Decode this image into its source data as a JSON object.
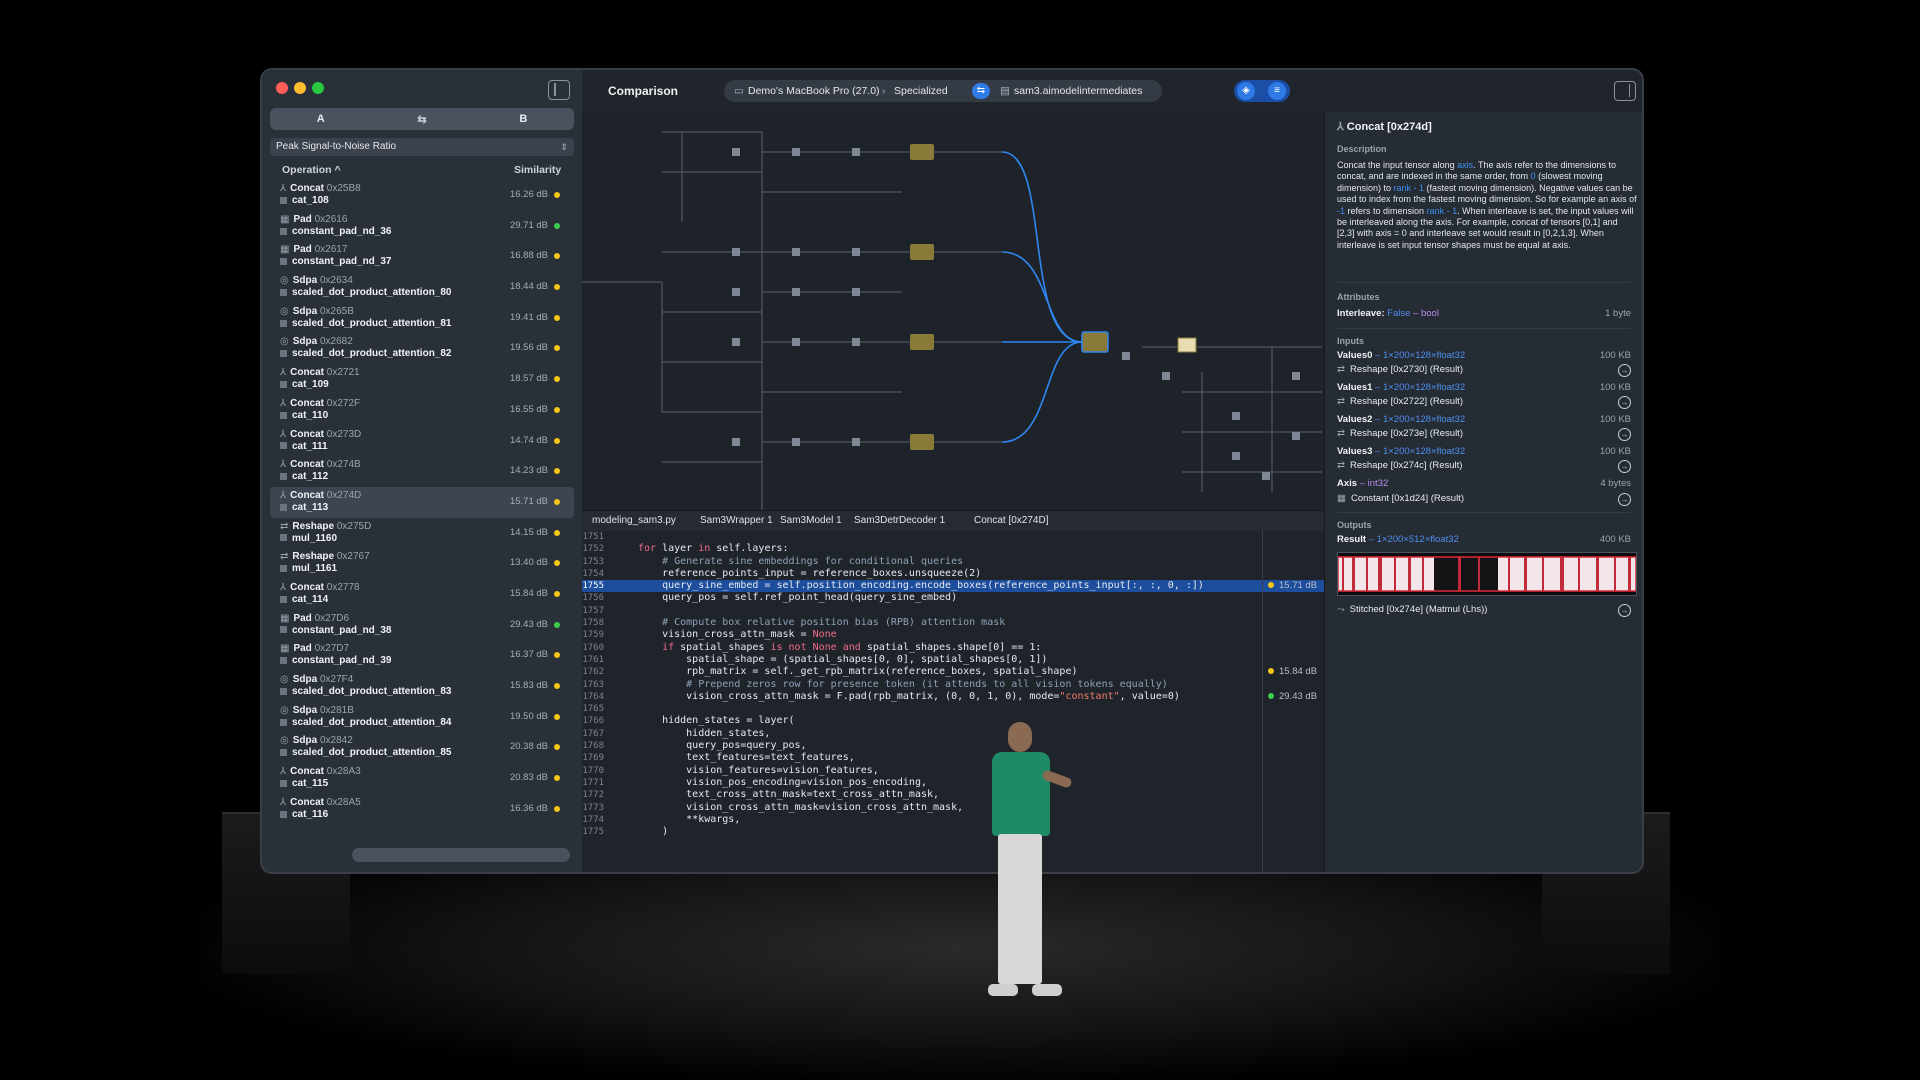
{
  "window": {
    "title": "Comparison",
    "breadcrumb": {
      "device": "Demo's MacBook Pro (27.0)",
      "mode": "Specialized",
      "file": "sam3.aimodelintermediates"
    }
  },
  "sidebar": {
    "segments": [
      "A",
      "⇆",
      "B"
    ],
    "metric": "Peak Signal-to-Noise Ratio",
    "col_operation": "Operation ^",
    "col_similarity": "Similarity",
    "colors": {
      "yellow": "#f5c518",
      "green": "#3ccf4e"
    },
    "ops": [
      {
        "type": "Concat",
        "addr": "0x25B8",
        "name": "cat_108",
        "sim": "16.26 dB",
        "dot": "yellow"
      },
      {
        "type": "Pad",
        "addr": "0x2616",
        "name": "constant_pad_nd_36",
        "sim": "29.71 dB",
        "dot": "green"
      },
      {
        "type": "Pad",
        "addr": "0x2617",
        "name": "constant_pad_nd_37",
        "sim": "16.88 dB",
        "dot": "yellow"
      },
      {
        "type": "Sdpa",
        "addr": "0x2634",
        "name": "scaled_dot_product_attention_80",
        "sim": "18.44 dB",
        "dot": "yellow"
      },
      {
        "type": "Sdpa",
        "addr": "0x265B",
        "name": "scaled_dot_product_attention_81",
        "sim": "19.41 dB",
        "dot": "yellow"
      },
      {
        "type": "Sdpa",
        "addr": "0x2682",
        "name": "scaled_dot_product_attention_82",
        "sim": "19.56 dB",
        "dot": "yellow"
      },
      {
        "type": "Concat",
        "addr": "0x2721",
        "name": "cat_109",
        "sim": "18.57 dB",
        "dot": "yellow"
      },
      {
        "type": "Concat",
        "addr": "0x272F",
        "name": "cat_110",
        "sim": "16.55 dB",
        "dot": "yellow"
      },
      {
        "type": "Concat",
        "addr": "0x273D",
        "name": "cat_111",
        "sim": "14.74 dB",
        "dot": "yellow"
      },
      {
        "type": "Concat",
        "addr": "0x274B",
        "name": "cat_112",
        "sim": "14.23 dB",
        "dot": "yellow"
      },
      {
        "type": "Concat",
        "addr": "0x274D",
        "name": "cat_113",
        "sim": "15.71 dB",
        "dot": "yellow",
        "selected": true
      },
      {
        "type": "Reshape",
        "addr": "0x275D",
        "name": "mul_1160",
        "sim": "14.15 dB",
        "dot": "yellow"
      },
      {
        "type": "Reshape",
        "addr": "0x2767",
        "name": "mul_1161",
        "sim": "13.40 dB",
        "dot": "yellow"
      },
      {
        "type": "Concat",
        "addr": "0x2778",
        "name": "cat_114",
        "sim": "15.84 dB",
        "dot": "yellow"
      },
      {
        "type": "Pad",
        "addr": "0x27D6",
        "name": "constant_pad_nd_38",
        "sim": "29.43 dB",
        "dot": "green"
      },
      {
        "type": "Pad",
        "addr": "0x27D7",
        "name": "constant_pad_nd_39",
        "sim": "16.37 dB",
        "dot": "yellow"
      },
      {
        "type": "Sdpa",
        "addr": "0x27F4",
        "name": "scaled_dot_product_attention_83",
        "sim": "15.83 dB",
        "dot": "yellow"
      },
      {
        "type": "Sdpa",
        "addr": "0x281B",
        "name": "scaled_dot_product_attention_84",
        "sim": "19.50 dB",
        "dot": "yellow"
      },
      {
        "type": "Sdpa",
        "addr": "0x2842",
        "name": "scaled_dot_product_attention_85",
        "sim": "20.38 dB",
        "dot": "yellow"
      },
      {
        "type": "Concat",
        "addr": "0x28A3",
        "name": "cat_115",
        "sim": "20.83 dB",
        "dot": "yellow"
      },
      {
        "type": "Concat",
        "addr": "0x28A5",
        "name": "cat_116",
        "sim": "16.36 dB",
        "dot": "yellow"
      }
    ]
  },
  "code": {
    "breadcrumb": [
      "modeling_sam3.py",
      "Sam3Wrapper 1",
      "Sam3Model 1",
      "Sam3DetrDecoder 1",
      "Concat [0x274D]"
    ],
    "highlight_line": "1755",
    "lines": [
      {
        "n": "1751",
        "t": ""
      },
      {
        "n": "1752",
        "t": "for layer in self.layers:",
        "cls": "k1"
      },
      {
        "n": "1753",
        "t": "    # Generate sine embeddings for conditional queries",
        "cls": "cm"
      },
      {
        "n": "1754",
        "t": "    reference_points_input = reference_boxes.unsqueeze(2)"
      },
      {
        "n": "1755",
        "t": "    query_sine_embed = self.position_encoding.encode_boxes(reference_points_input[:, :, 0, :])",
        "hl": true,
        "mark": "15.71 dB",
        "dot": "yellow"
      },
      {
        "n": "1756",
        "t": "    query_pos = self.ref_point_head(query_sine_embed)"
      },
      {
        "n": "1757",
        "t": ""
      },
      {
        "n": "1758",
        "t": "    # Compute box relative position bias (RPB) attention mask",
        "cls": "cm"
      },
      {
        "n": "1759",
        "t": "    vision_cross_attn_mask = None"
      },
      {
        "n": "1760",
        "t": "    if spatial_shapes is not None and spatial_shapes.shape[0] == 1:",
        "cls": "k2"
      },
      {
        "n": "1761",
        "t": "        spatial_shape = (spatial_shapes[0, 0], spatial_shapes[0, 1])"
      },
      {
        "n": "1762",
        "t": "        rpb_matrix = self._get_rpb_matrix(reference_boxes, spatial_shape)",
        "mark": "15.84 dB",
        "dot": "yellow"
      },
      {
        "n": "1763",
        "t": "        # Prepend zeros row for presence token (it attends to all vision tokens equally)",
        "cls": "cm"
      },
      {
        "n": "1764",
        "t": "        vision_cross_attn_mask = F.pad(rpb_matrix, (0, 0, 1, 0), mode=\"constant\", value=0)",
        "mark": "29.43 dB",
        "dot": "green"
      },
      {
        "n": "1765",
        "t": ""
      },
      {
        "n": "1766",
        "t": "    hidden_states = layer("
      },
      {
        "n": "1767",
        "t": "        hidden_states,"
      },
      {
        "n": "1768",
        "t": "        query_pos=query_pos,"
      },
      {
        "n": "1769",
        "t": "        text_features=text_features,"
      },
      {
        "n": "1770",
        "t": "        vision_features=vision_features,"
      },
      {
        "n": "1771",
        "t": "        vision_pos_encoding=vision_pos_encoding,"
      },
      {
        "n": "1772",
        "t": "        text_cross_attn_mask=text_cross_attn_mask,"
      },
      {
        "n": "1773",
        "t": "        vision_cross_attn_mask=vision_cross_attn_mask,"
      },
      {
        "n": "1774",
        "t": "        **kwargs,"
      },
      {
        "n": "1775",
        "t": "    )"
      }
    ]
  },
  "inspector": {
    "title": "Concat [0x274d]",
    "description_label": "Description",
    "description_parts": [
      {
        "t": "Concat the input tensor along "
      },
      {
        "t": "axis",
        "h": true
      },
      {
        "t": ". The axis refer to the dimensions to concat, and are indexed in the same order, from "
      },
      {
        "t": "0",
        "h": true
      },
      {
        "t": " (slowest moving dimension) to "
      },
      {
        "t": "rank - 1",
        "h": true
      },
      {
        "t": " (fastest moving dimension). Negative values can be used to index from the fastest moving dimension. So for example an axis of "
      },
      {
        "t": "-1",
        "h": true
      },
      {
        "t": " refers to dimension "
      },
      {
        "t": "rank - 1",
        "h": true
      },
      {
        "t": ". When interleave is set, the input values will be interleaved along the axis. For example, concat of tensors [0,1] and [2,3] with axis = 0 and interleave set would result in [0,2,1,3]. When interleave is set input tensor shapes must be equal at axis."
      }
    ],
    "attributes_label": "Attributes",
    "interleave": {
      "key": "Interleave:",
      "value": "False",
      "type": "bool",
      "size": "1 byte"
    },
    "inputs_label": "Inputs",
    "inputs": [
      {
        "key": "Values0",
        "type": "1×200×128×float32",
        "size": "100 KB",
        "source": "Reshape [0x2730] (Result)"
      },
      {
        "key": "Values1",
        "type": "1×200×128×float32",
        "size": "100 KB",
        "source": "Reshape [0x2722] (Result)"
      },
      {
        "key": "Values2",
        "type": "1×200×128×float32",
        "size": "100 KB",
        "source": "Reshape [0x273e] (Result)"
      },
      {
        "key": "Values3",
        "type": "1×200×128×float32",
        "size": "100 KB",
        "source": "Reshape [0x274c] (Result)"
      }
    ],
    "axis": {
      "key": "Axis",
      "type": "int32",
      "size": "4 bytes",
      "source": "Constant [0x1d24] (Result)"
    },
    "outputs_label": "Outputs",
    "result": {
      "key": "Result",
      "type": "1×200×512×float32",
      "size": "400 KB"
    },
    "consumer": "Stitched [0x274e] (Matmul (Lhs))"
  }
}
